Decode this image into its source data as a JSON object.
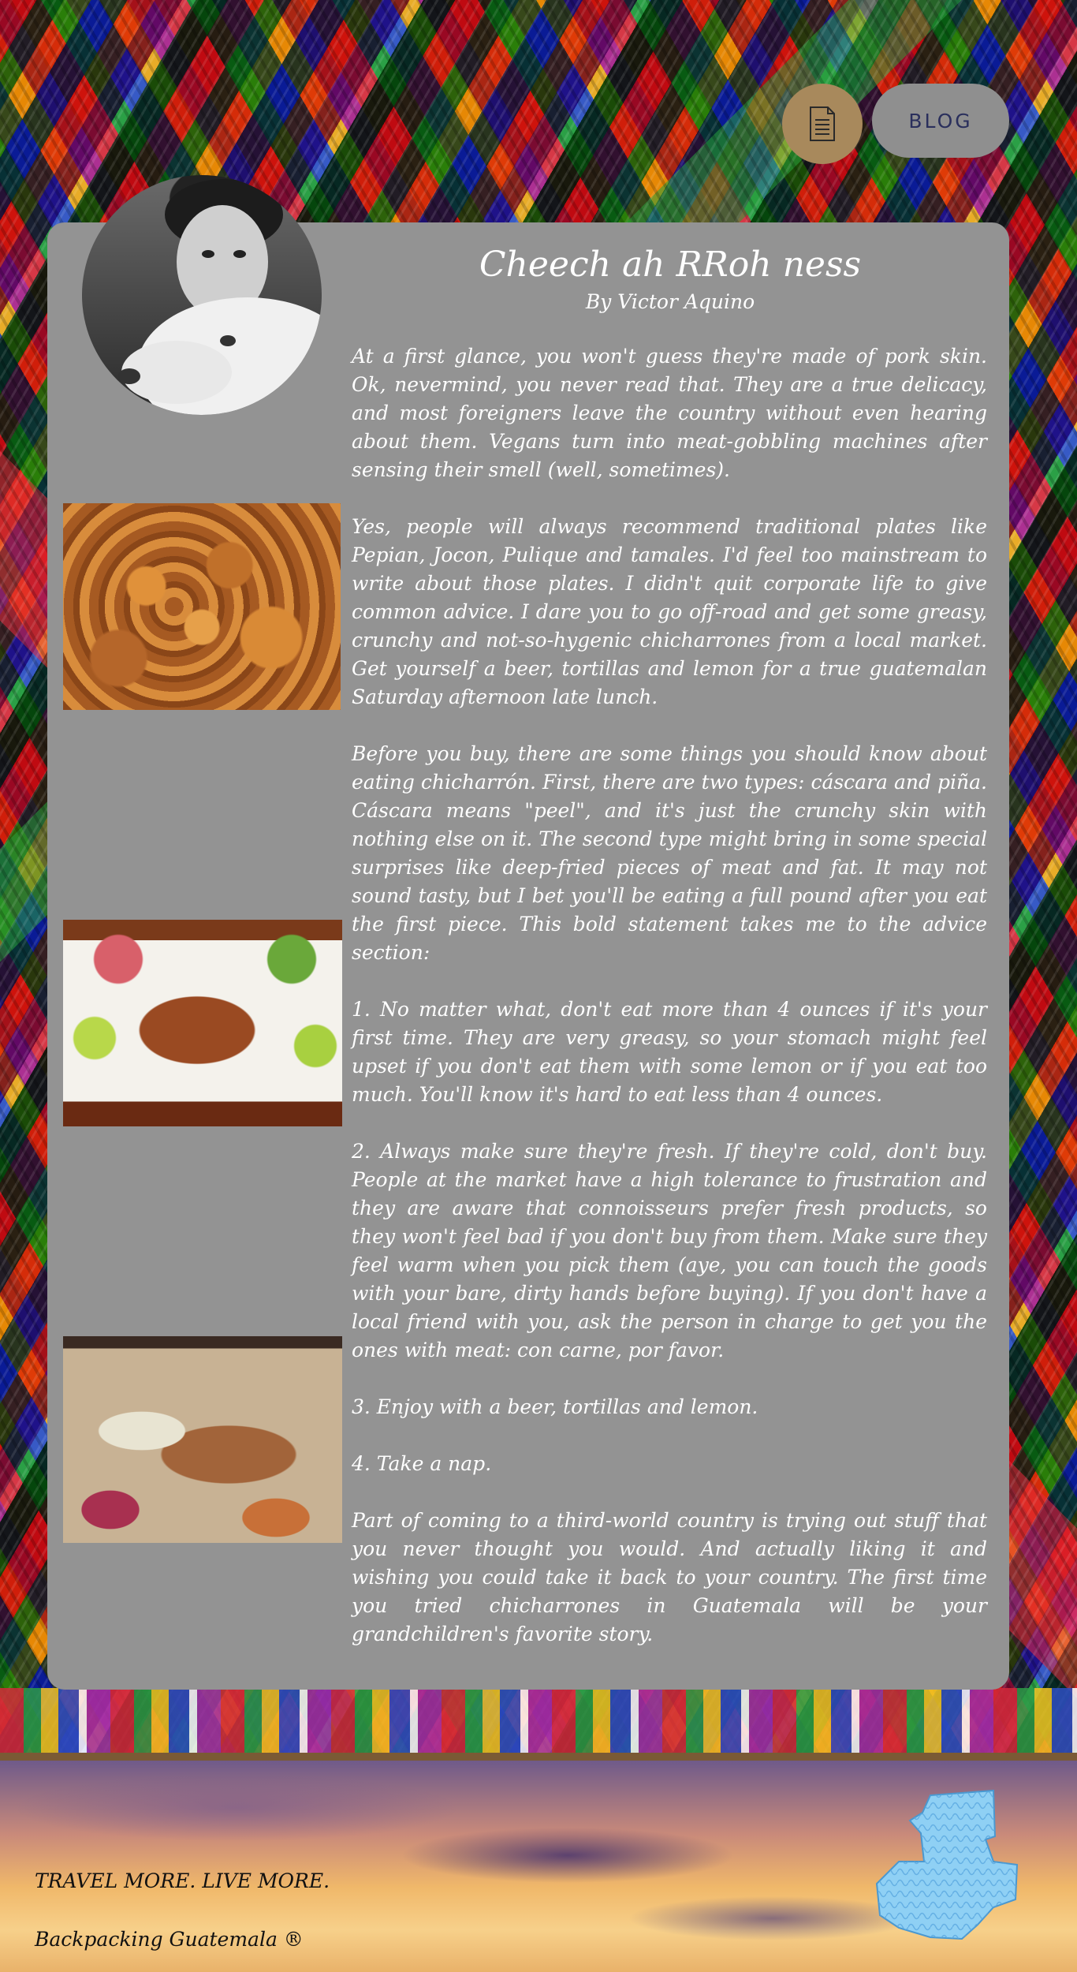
{
  "nav": {
    "doc_icon": "document-icon",
    "blog_label": "BLOG"
  },
  "article": {
    "title": "Cheech ah RRoh ness",
    "byline": "By Victor Aquino",
    "paragraphs": [
      "At a first glance, you won't guess they're made of pork skin. Ok, nevermind, you never read that. They are a true delicacy, and most foreigners leave the country without even hearing about them. Vegans turn into meat-gobbling machines after sensing their smell (well, sometimes).",
      "Yes, people will always recommend traditional plates like Pepian, Jocon, Pulique and tamales. I'd feel too mainstream to write about those plates. I didn't quit corporate life to give common advice. I dare you to go off-road and get some greasy, crunchy and not-so-hygenic chicharrones from a local market. Get yourself a beer, tortillas and lemon for a true guatemalan Saturday afternoon late lunch.",
      "Before you buy, there are some things you should know about eating chicharrón. First, there are two types: cáscara and piña. Cáscara means \"peel\", and it's just the crunchy skin with nothing else on it. The second type might bring in some special surprises like deep-fried pieces of meat and fat. It may not sound tasty, but I bet you'll be eating a full pound after you eat the first piece. This bold statement takes me to the advice section:",
      "1. No matter what, don't eat more than 4 ounces if it's your first time. They are very greasy, so your stomach might feel upset if you don't eat them with some lemon or if you eat too much. You'll know it's hard to eat less than 4 ounces.",
      "2. Always make sure they're fresh. If they're cold, don't buy. People at the market have a high tolerance to frustration and they are aware that connoisseurs prefer fresh products, so they won't feel bad if you don't buy from them. Make sure they feel warm when you pick them (aye, you can touch the goods with your bare, dirty hands before buying). If you don't have a local friend with you, ask the person in charge to get you the ones with meat: con carne, por favor.",
      "3. Enjoy with a beer, tortillas and lemon.",
      "4. Take a nap.",
      "Part of coming to a third-world country is trying out stuff that you never thought you would. And actually liking it and wishing you could take it back to your country. The first time you tried chicharrones in Guatemala will be your grandchildren's favorite story."
    ]
  },
  "footer": {
    "tagline": "TRAVEL MORE. LIVE MORE.",
    "brand": "Backpacking Guatemala ®",
    "map_icon": "guatemala-map-icon"
  }
}
